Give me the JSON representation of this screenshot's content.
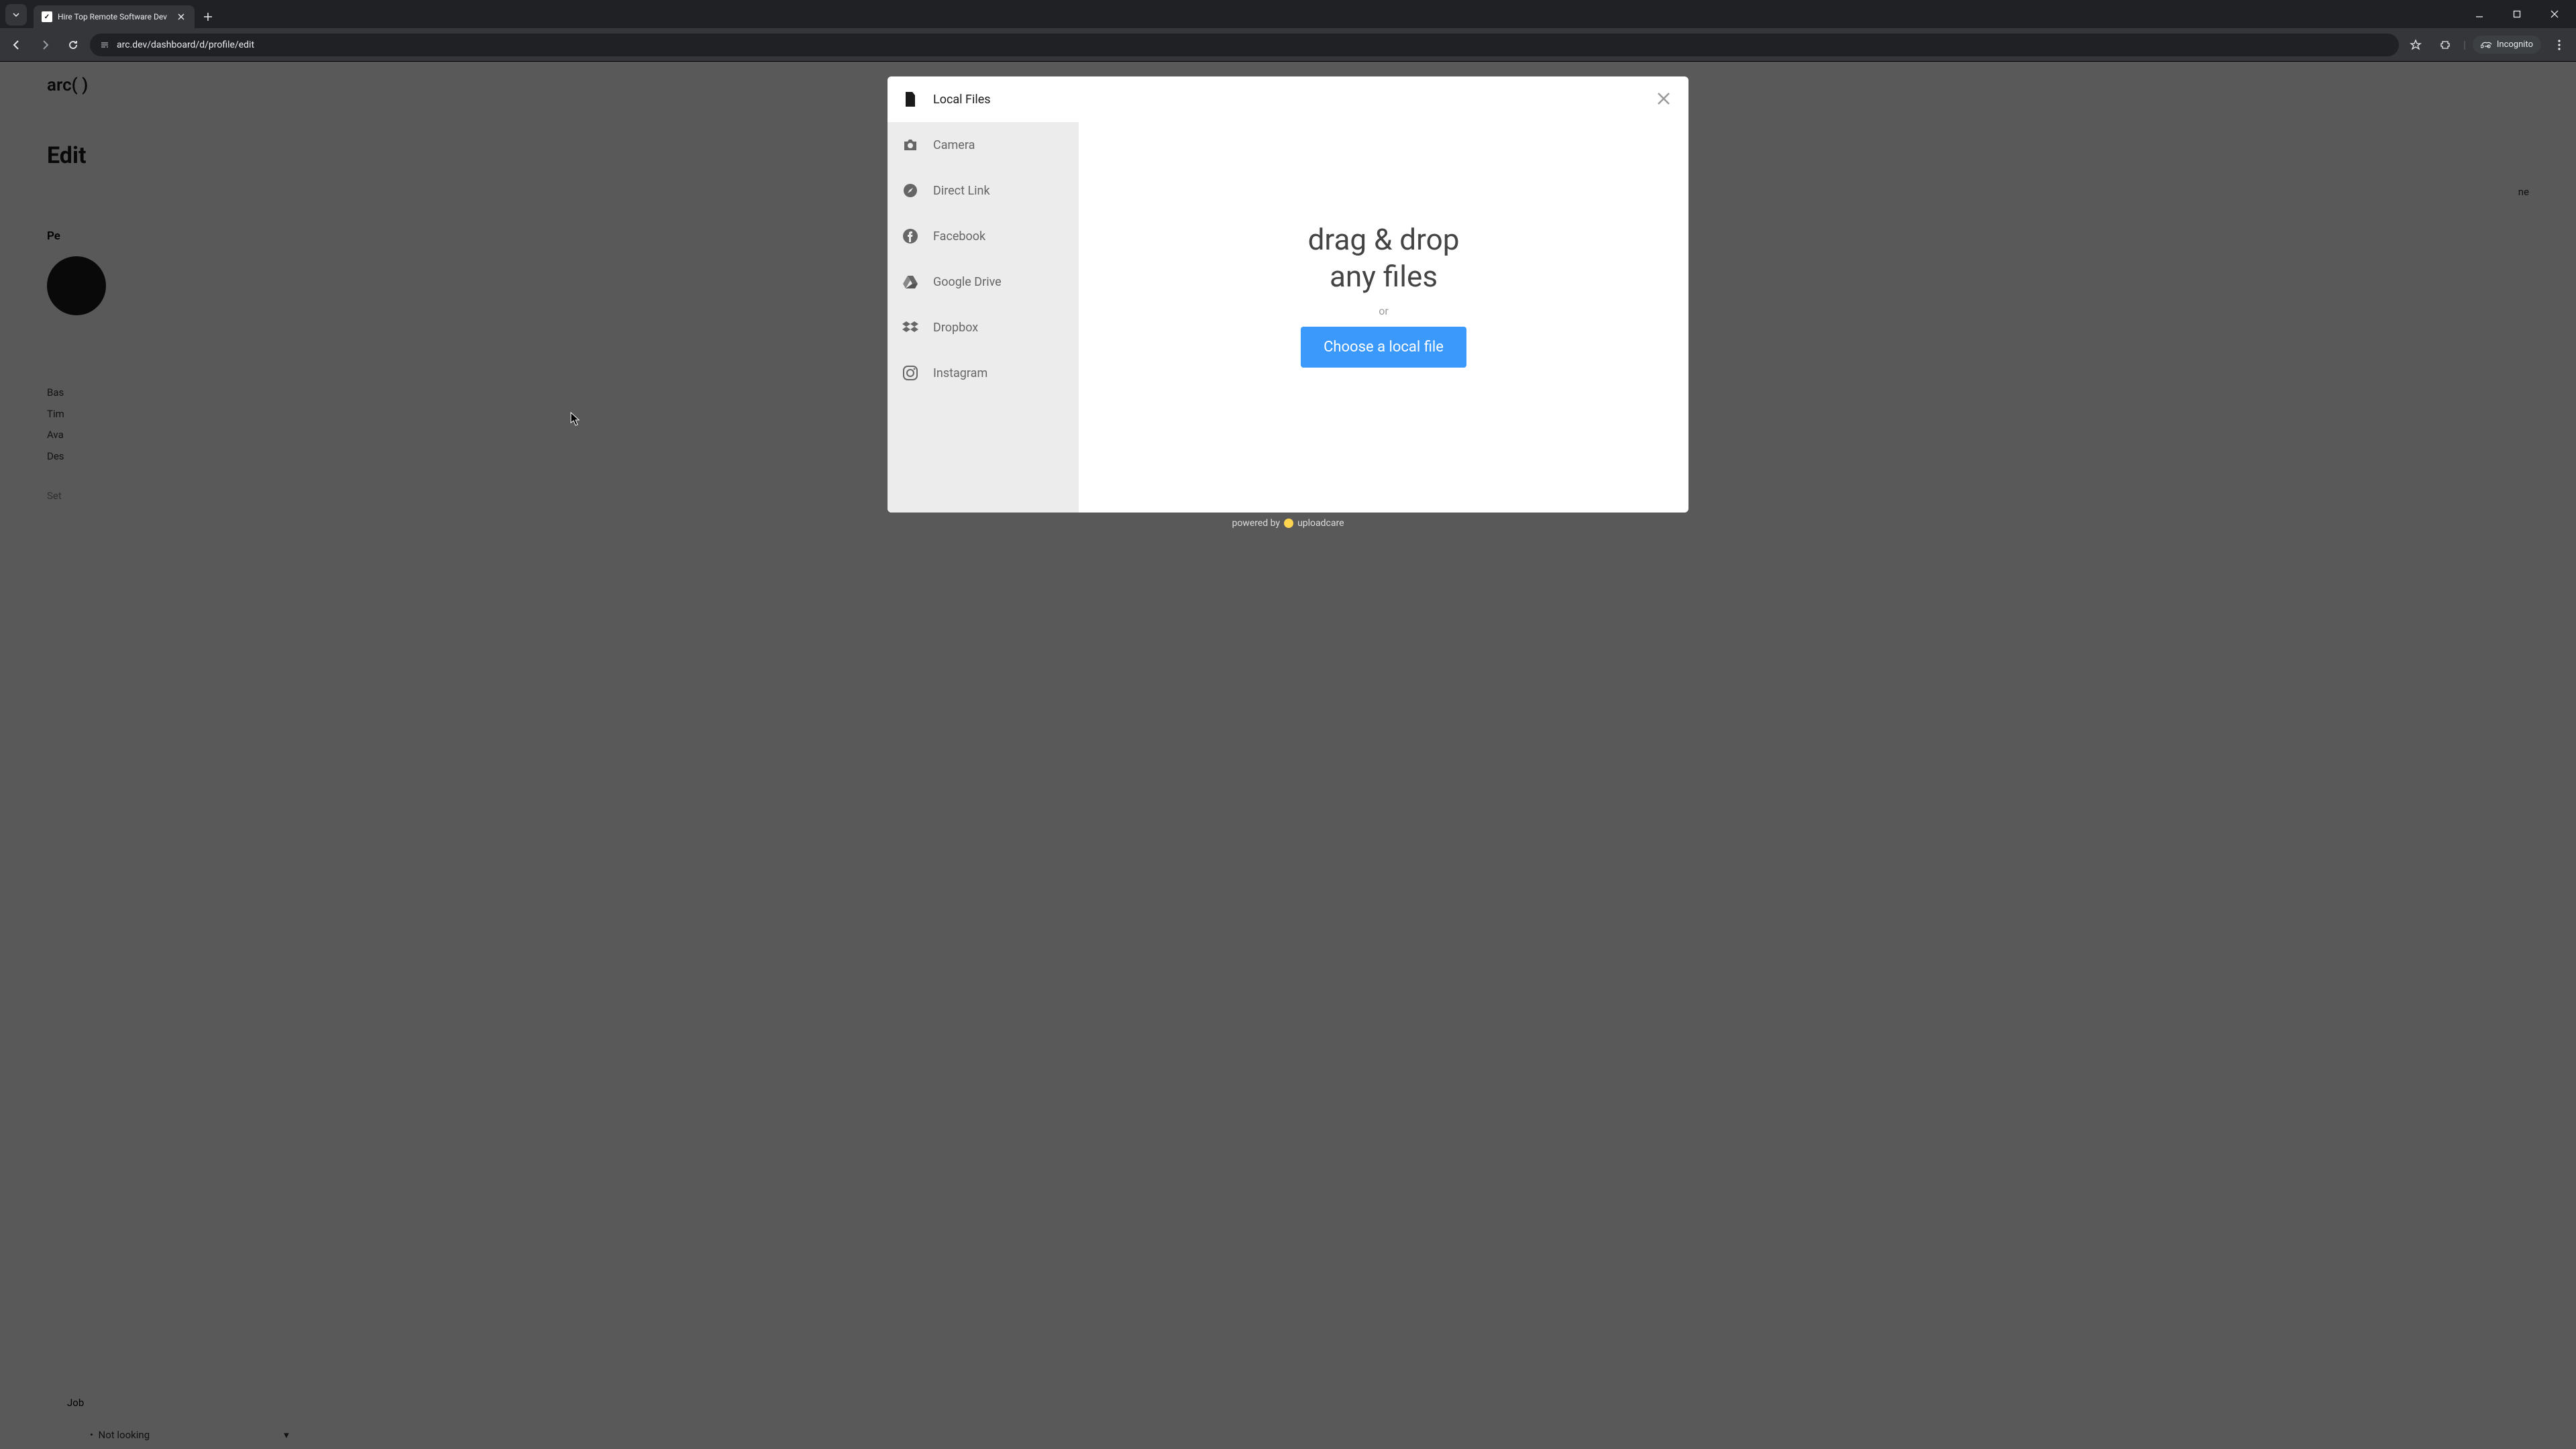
{
  "browser": {
    "tab_title": "Hire Top Remote Software Dev",
    "url": "arc.dev/dashboard/d/profile/edit",
    "incognito_label": "Incognito"
  },
  "page_bg": {
    "logo": "arc( )",
    "heading": "Edit",
    "label_pe": "Pe",
    "label_bas": "Bas",
    "label_tim": "Tim",
    "label_ava": "Ava",
    "label_des": "Des",
    "label_set": "Set",
    "right_text": "ne",
    "bottom_label": "Job",
    "dropdown_text": "Not looking"
  },
  "modal": {
    "sources": {
      "local_files": "Local Files",
      "camera": "Camera",
      "direct_link": "Direct Link",
      "facebook": "Facebook",
      "google_drive": "Google Drive",
      "dropbox": "Dropbox",
      "instagram": "Instagram"
    },
    "drop_line1": "drag & drop",
    "drop_line2": "any files",
    "or": "or",
    "choose_button": "Choose a local file"
  },
  "footer": {
    "powered_by": "powered by",
    "brand": "uploadcare"
  }
}
